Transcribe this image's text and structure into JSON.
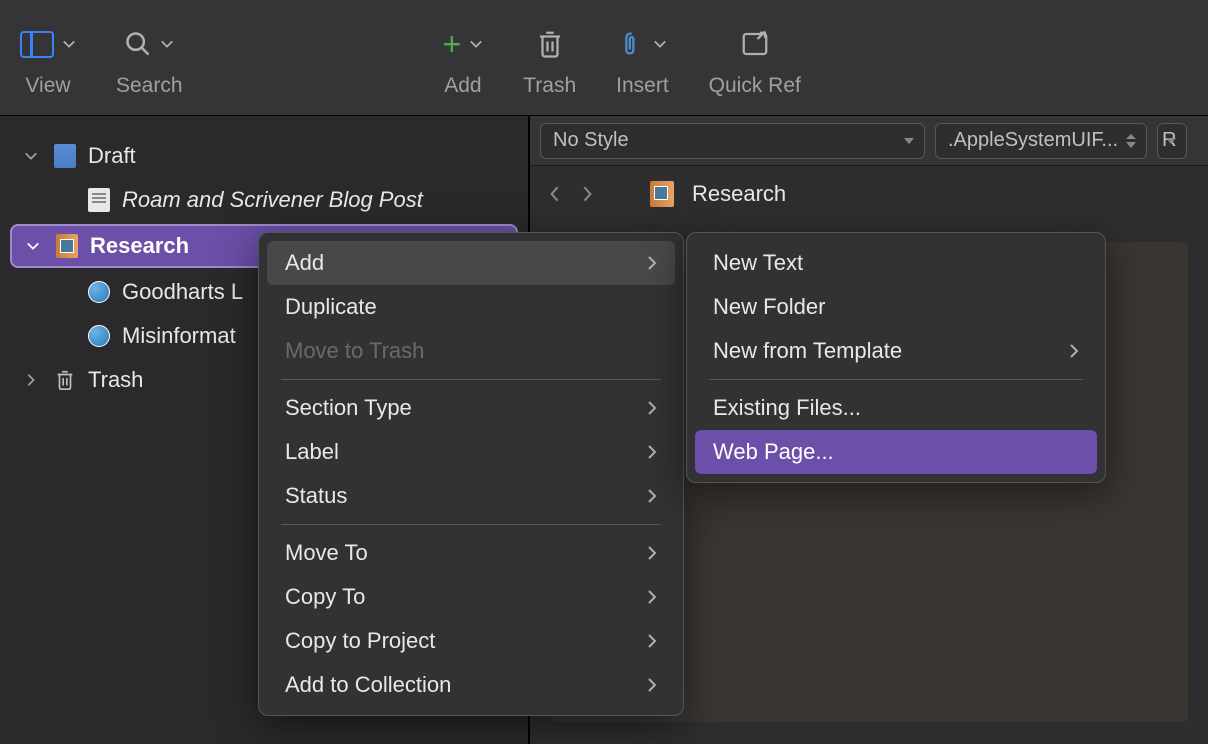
{
  "toolbar": {
    "view_label": "View",
    "search_label": "Search",
    "add_label": "Add",
    "trash_label": "Trash",
    "insert_label": "Insert",
    "quickref_label": "Quick Ref"
  },
  "sidebar": {
    "draft_label": "Draft",
    "blog_post_label": "Roam and Scrivener Blog Post",
    "research_label": "Research",
    "goodharts_label": "Goodharts L",
    "misinfo_label": "Misinformat",
    "trash_label": "Trash"
  },
  "editor": {
    "style_select": "No Style",
    "font_select": ".AppleSystemUIF...",
    "re_select": "R",
    "breadcrumb": "Research"
  },
  "context_menu": {
    "add": "Add",
    "duplicate": "Duplicate",
    "move_to_trash": "Move to Trash",
    "section_type": "Section Type",
    "label": "Label",
    "status": "Status",
    "move_to": "Move To",
    "copy_to": "Copy To",
    "copy_to_project": "Copy to Project",
    "add_to_collection": "Add to Collection"
  },
  "submenu": {
    "new_text": "New Text",
    "new_folder": "New Folder",
    "new_from_template": "New from Template",
    "existing_files": "Existing Files...",
    "web_page": "Web Page..."
  }
}
